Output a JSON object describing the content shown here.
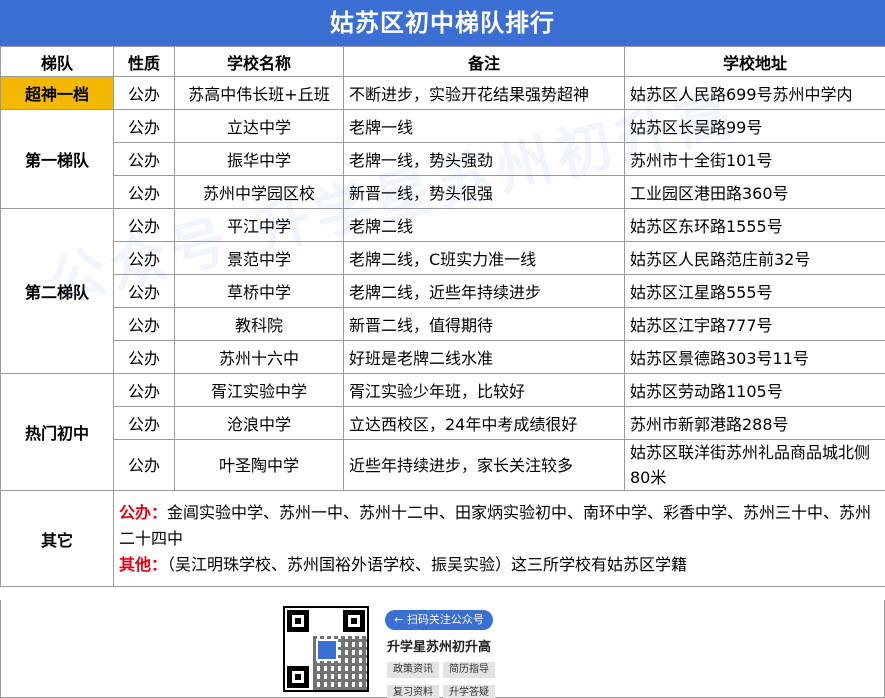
{
  "title": "姑苏区初中梯队排行",
  "watermark": "公众号 升学星苏州初升高",
  "headers": [
    "梯队",
    "性质",
    "学校名称",
    "备注",
    "学校地址"
  ],
  "groups": [
    {
      "tier": "超神一档",
      "highlight": true,
      "rows": [
        {
          "type": "公办",
          "name": "苏高中伟长班+丘班",
          "note": "不断进步，实验开花结果强势超神",
          "addr": "姑苏区人民路699号苏州中学内"
        }
      ]
    },
    {
      "tier": "第一梯队",
      "rows": [
        {
          "type": "公办",
          "name": "立达中学",
          "note": "老牌一线",
          "addr": "姑苏区长吴路99号"
        },
        {
          "type": "公办",
          "name": "振华中学",
          "note": "老牌一线，势头强劲",
          "addr": "苏州市十全街101号"
        },
        {
          "type": "公办",
          "name": "苏州中学园区校",
          "note": "新晋一线，势头很强",
          "addr": "工业园区港田路360号"
        }
      ]
    },
    {
      "tier": "第二梯队",
      "rows": [
        {
          "type": "公办",
          "name": "平江中学",
          "note": "老牌二线",
          "addr": "姑苏区东环路1555号"
        },
        {
          "type": "公办",
          "name": "景范中学",
          "note": "老牌二线，C班实力准一线",
          "addr": "姑苏区人民路范庄前32号"
        },
        {
          "type": "公办",
          "name": "草桥中学",
          "note": "老牌二线，近些年持续进步",
          "addr": "姑苏区江星路555号"
        },
        {
          "type": "公办",
          "name": "教科院",
          "note": "新晋二线，值得期待",
          "addr": "姑苏区江宇路777号"
        },
        {
          "type": "公办",
          "name": "苏州十六中",
          "note": "好班是老牌二线水准",
          "addr": "姑苏区景德路303号11号"
        }
      ]
    },
    {
      "tier": "热门初中",
      "rows": [
        {
          "type": "公办",
          "name": "胥江实验中学",
          "note": "胥江实验少年班，比较好",
          "addr": "姑苏区劳动路1105号"
        },
        {
          "type": "公办",
          "name": "沧浪中学",
          "note": "立达西校区，24年中考成绩很好",
          "addr": "苏州市新郭港路288号"
        },
        {
          "type": "公办",
          "name": "叶圣陶中学",
          "note": "近些年持续进步，家长关注较多",
          "addr": "姑苏区联洋街苏州礼品商品城北侧80米"
        }
      ]
    }
  ],
  "other": {
    "tier": "其它",
    "public_label": "公办：",
    "public_text": "金阊实验中学、苏州一中、苏州十二中、田家炳实验初中、南环中学、彩香中学、苏州三十中、苏州二十四中",
    "misc_label": "其他：",
    "misc_text": "（吴江明珠学校、苏州国裕外语学校、振吴实验）这三所学校有姑苏区学籍"
  },
  "footer": {
    "qr_button": "← 扫码关注公众号",
    "account_name": "升学星苏州初升高",
    "tags": [
      "政策资讯",
      "简历指导",
      "复习资料",
      "升学答疑"
    ],
    "qr_icon": "qr-code-icon"
  },
  "colors": {
    "title_bg": "#3b6fd4",
    "highlight_bg": "#f5b800",
    "label_red": "#e60012"
  }
}
